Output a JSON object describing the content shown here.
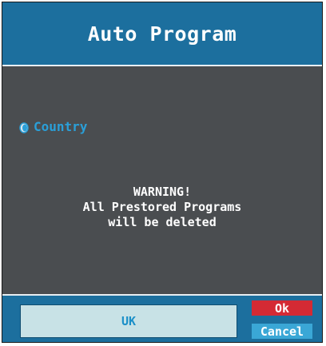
{
  "dialog": {
    "title": "Auto Program"
  },
  "country": {
    "label": "Country",
    "icon": "radio-bullet-icon"
  },
  "warning": {
    "line1": "WARNING!",
    "line2": "All Prestored Programs",
    "line3": "will be deleted"
  },
  "footer": {
    "selected_country": "UK",
    "ok_label": "Ok",
    "cancel_label": "Cancel"
  },
  "colors": {
    "title_bar": "#1c6f9e",
    "body": "#4a4d50",
    "accent_text": "#2a9fd8",
    "ok": "#d42a34",
    "cancel": "#3aa7d6",
    "select_bg": "#c8e2e6"
  }
}
